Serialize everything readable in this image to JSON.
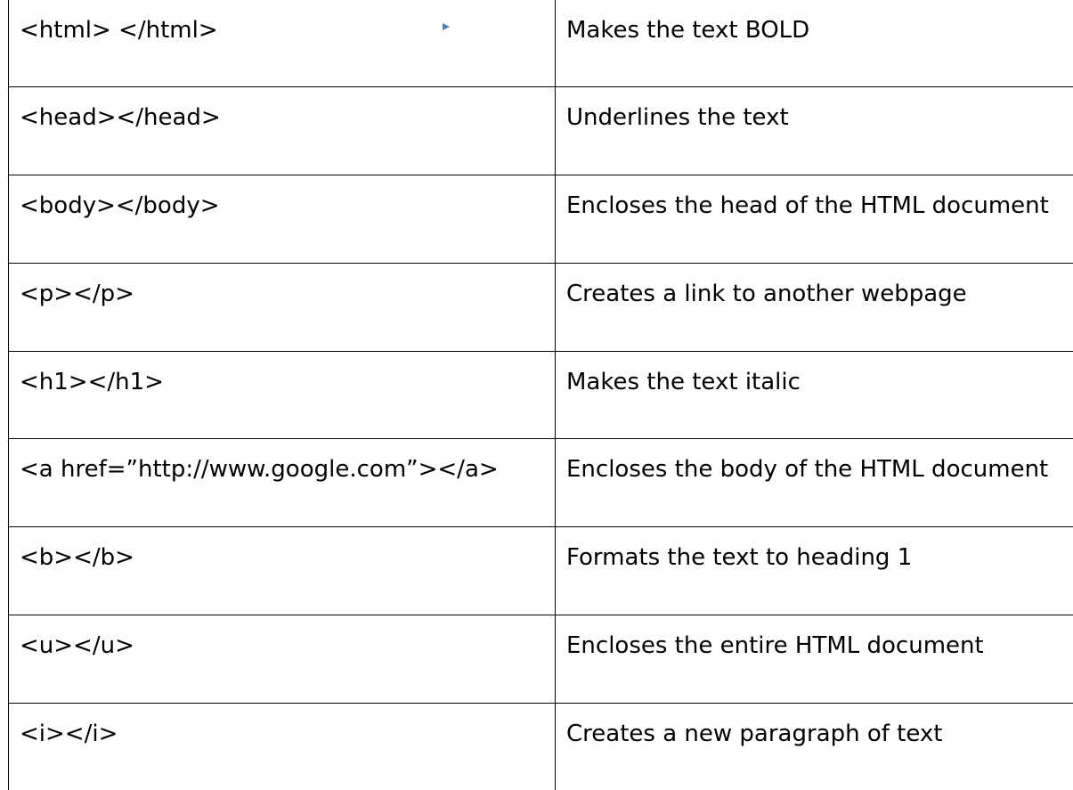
{
  "rows": [
    {
      "tag": "<html> </html>",
      "description": "Makes the text BOLD"
    },
    {
      "tag": "<head></head>",
      "description": "Underlines the text"
    },
    {
      "tag": "<body></body>",
      "description": "Encloses the head of the HTML document"
    },
    {
      "tag": "<p></p>",
      "description": "Creates a link to another webpage"
    },
    {
      "tag": "<h1></h1>",
      "description": "Makes the text italic"
    },
    {
      "tag": "<a href=”http://www.google.com”></a>",
      "description": "Encloses the body of the HTML document"
    },
    {
      "tag": "<b></b>",
      "description": "Formats the text to heading 1"
    },
    {
      "tag": "<u></u>",
      "description": "Encloses the entire HTML document"
    },
    {
      "tag": "<i></i>",
      "description": "Creates a new paragraph of text"
    }
  ],
  "arrow": {
    "icon": "arrow-right-icon",
    "color": "#5b8cc8"
  }
}
